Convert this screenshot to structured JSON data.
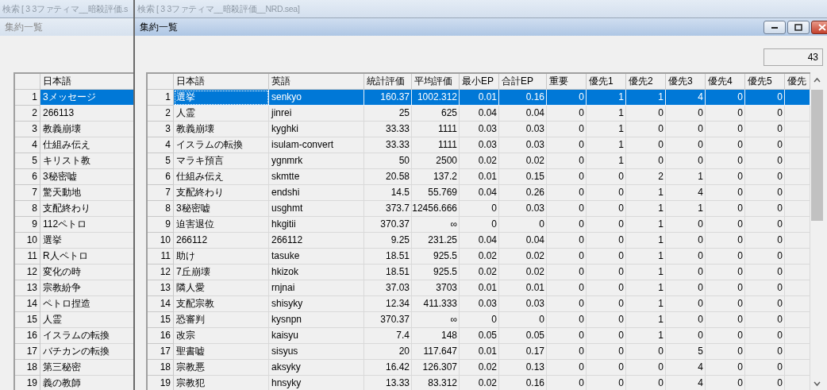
{
  "background_windows": [
    {
      "title": "検索 [ 3 3ファティマ__暗殺評価.s"
    },
    {
      "title": "検索 [ 3 3ファティマ__暗殺評価__NRD.sea]"
    }
  ],
  "left_window": {
    "title": "集約一覧",
    "active": false,
    "table": {
      "columns": [
        "日本語"
      ],
      "rows": [
        {
          "number": "1",
          "cells": [
            "3メッセージ"
          ],
          "selected": true
        },
        {
          "number": "2",
          "cells": [
            "266113"
          ],
          "selected": false
        },
        {
          "number": "3",
          "cells": [
            "教義崩壊"
          ],
          "selected": false
        },
        {
          "number": "4",
          "cells": [
            "仕組み伝え"
          ],
          "selected": false
        },
        {
          "number": "5",
          "cells": [
            "キリスト教"
          ],
          "selected": false
        },
        {
          "number": "6",
          "cells": [
            "3秘密嘘"
          ],
          "selected": false
        },
        {
          "number": "7",
          "cells": [
            "驚天動地"
          ],
          "selected": false
        },
        {
          "number": "8",
          "cells": [
            "支配終わり"
          ],
          "selected": false
        },
        {
          "number": "9",
          "cells": [
            "112ペトロ"
          ],
          "selected": false
        },
        {
          "number": "10",
          "cells": [
            "選挙"
          ],
          "selected": false
        },
        {
          "number": "11",
          "cells": [
            "R人ペトロ"
          ],
          "selected": false
        },
        {
          "number": "12",
          "cells": [
            "変化の時"
          ],
          "selected": false
        },
        {
          "number": "13",
          "cells": [
            "宗教紛争"
          ],
          "selected": false
        },
        {
          "number": "14",
          "cells": [
            "ペトロ捏造"
          ],
          "selected": false
        },
        {
          "number": "15",
          "cells": [
            "人霊"
          ],
          "selected": false
        },
        {
          "number": "16",
          "cells": [
            "イスラムの転換"
          ],
          "selected": false
        },
        {
          "number": "17",
          "cells": [
            "バチカンの転換"
          ],
          "selected": false
        },
        {
          "number": "18",
          "cells": [
            "第三秘密"
          ],
          "selected": false
        },
        {
          "number": "19",
          "cells": [
            "義の教師"
          ],
          "selected": false
        }
      ]
    }
  },
  "main_window": {
    "title": "集約一覧",
    "active": true,
    "count": "43",
    "table": {
      "columns": [
        "日本語",
        "英語",
        "統計評価",
        "平均評価",
        "最小EP",
        "合計EP",
        "重要",
        "優先1",
        "優先2",
        "優先3",
        "優先4",
        "優先5",
        "優先"
      ],
      "rows": [
        {
          "number": "1",
          "cells": [
            "選挙",
            "senkyo",
            "160.37",
            "1002.312",
            "0.01",
            "0.16",
            "0",
            "1",
            "1",
            "4",
            "0",
            "0"
          ],
          "selected": true
        },
        {
          "number": "2",
          "cells": [
            "人霊",
            "jinrei",
            "25",
            "625",
            "0.04",
            "0.04",
            "0",
            "1",
            "0",
            "0",
            "0",
            "0"
          ],
          "selected": false
        },
        {
          "number": "3",
          "cells": [
            "教義崩壊",
            "kyghki",
            "33.33",
            "1111",
            "0.03",
            "0.03",
            "0",
            "1",
            "0",
            "0",
            "0",
            "0"
          ],
          "selected": false
        },
        {
          "number": "4",
          "cells": [
            "イスラムの転換",
            "isulam-convert",
            "33.33",
            "1111",
            "0.03",
            "0.03",
            "0",
            "1",
            "0",
            "0",
            "0",
            "0"
          ],
          "selected": false
        },
        {
          "number": "5",
          "cells": [
            "マラキ預言",
            "ygnmrk",
            "50",
            "2500",
            "0.02",
            "0.02",
            "0",
            "1",
            "0",
            "0",
            "0",
            "0"
          ],
          "selected": false
        },
        {
          "number": "6",
          "cells": [
            "仕組み伝え",
            "skmtte",
            "20.58",
            "137.2",
            "0.01",
            "0.15",
            "0",
            "0",
            "2",
            "1",
            "0",
            "0"
          ],
          "selected": false
        },
        {
          "number": "7",
          "cells": [
            "支配終わり",
            "endshi",
            "14.5",
            "55.769",
            "0.04",
            "0.26",
            "0",
            "0",
            "1",
            "4",
            "0",
            "0"
          ],
          "selected": false
        },
        {
          "number": "8",
          "cells": [
            "3秘密嘘",
            "usghmt",
            "373.7",
            "12456.666",
            "0",
            "0.03",
            "0",
            "0",
            "1",
            "1",
            "0",
            "0"
          ],
          "selected": false
        },
        {
          "number": "9",
          "cells": [
            "迫害退位",
            "hkgitii",
            "370.37",
            "∞",
            "0",
            "0",
            "0",
            "0",
            "1",
            "0",
            "0",
            "0"
          ],
          "selected": false
        },
        {
          "number": "10",
          "cells": [
            "266112",
            "266112",
            "9.25",
            "231.25",
            "0.04",
            "0.04",
            "0",
            "0",
            "1",
            "0",
            "0",
            "0"
          ],
          "selected": false
        },
        {
          "number": "11",
          "cells": [
            "助け",
            "tasuke",
            "18.51",
            "925.5",
            "0.02",
            "0.02",
            "0",
            "0",
            "1",
            "0",
            "0",
            "0"
          ],
          "selected": false
        },
        {
          "number": "12",
          "cells": [
            "7丘崩壊",
            "hkizok",
            "18.51",
            "925.5",
            "0.02",
            "0.02",
            "0",
            "0",
            "1",
            "0",
            "0",
            "0"
          ],
          "selected": false
        },
        {
          "number": "13",
          "cells": [
            "隣人愛",
            "rnjnai",
            "37.03",
            "3703",
            "0.01",
            "0.01",
            "0",
            "0",
            "1",
            "0",
            "0",
            "0"
          ],
          "selected": false
        },
        {
          "number": "14",
          "cells": [
            "支配宗教",
            "shisyky",
            "12.34",
            "411.333",
            "0.03",
            "0.03",
            "0",
            "0",
            "1",
            "0",
            "0",
            "0"
          ],
          "selected": false
        },
        {
          "number": "15",
          "cells": [
            "恐審判",
            "kysnpn",
            "370.37",
            "∞",
            "0",
            "0",
            "0",
            "0",
            "1",
            "0",
            "0",
            "0"
          ],
          "selected": false
        },
        {
          "number": "16",
          "cells": [
            "改宗",
            "kaisyu",
            "7.4",
            "148",
            "0.05",
            "0.05",
            "0",
            "0",
            "1",
            "0",
            "0",
            "0"
          ],
          "selected": false
        },
        {
          "number": "17",
          "cells": [
            "聖書嘘",
            "sisyus",
            "20",
            "117.647",
            "0.01",
            "0.17",
            "0",
            "0",
            "0",
            "5",
            "0",
            "0"
          ],
          "selected": false
        },
        {
          "number": "18",
          "cells": [
            "宗教悪",
            "aksyky",
            "16.42",
            "126.307",
            "0.02",
            "0.13",
            "0",
            "0",
            "0",
            "4",
            "0",
            "0"
          ],
          "selected": false
        },
        {
          "number": "19",
          "cells": [
            "宗教犯",
            "hnsyky",
            "13.33",
            "83.312",
            "0.02",
            "0.16",
            "0",
            "0",
            "0",
            "4",
            "0",
            "0"
          ],
          "selected": false
        }
      ]
    }
  }
}
